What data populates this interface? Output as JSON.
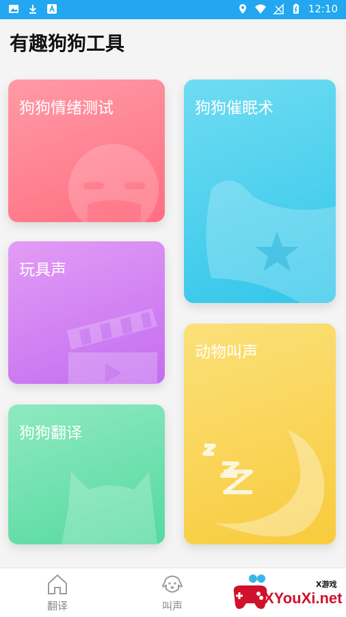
{
  "status_bar": {
    "time": "12:10"
  },
  "page_title": "有趣狗狗工具",
  "cards": {
    "mood_test": "狗狗情绪测试",
    "hypnosis": "狗狗催眠术",
    "toy_sound": "玩具声",
    "animal_sound": "动物叫声",
    "translate": "狗狗翻译"
  },
  "tabs": {
    "translate": "翻译",
    "bark": "叫声"
  },
  "watermark": {
    "brand": "XYouXi.net",
    "tag": "X游戏"
  }
}
